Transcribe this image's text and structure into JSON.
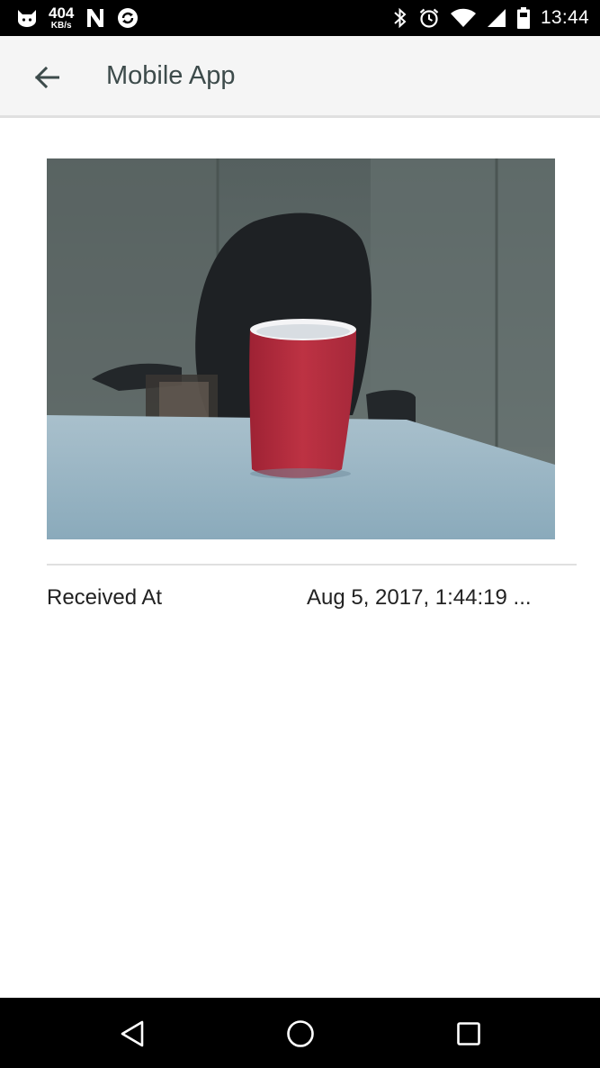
{
  "status_bar": {
    "net_speed_value": "404",
    "net_speed_unit": "KB/s",
    "time": "13:44",
    "left_icons": [
      "cat-icon",
      "network-speed",
      "n-icon",
      "sync-icon"
    ],
    "right_icons": [
      "bluetooth-icon",
      "alarm-icon",
      "wifi-icon",
      "signal-icon",
      "battery-icon"
    ]
  },
  "app_bar": {
    "title": "Mobile App",
    "back_icon": "arrow-left-icon"
  },
  "content": {
    "image": {
      "description_icon": "photo-red-cup-on-desk",
      "colors": {
        "cup": "#b12d3f",
        "desk": "#8fafc0",
        "wall": "#5f6b69",
        "chair": "#1e2124"
      }
    },
    "detail": {
      "label": "Received At",
      "value": "Aug 5, 2017, 1:44:19 ..."
    }
  },
  "nav_bar": {
    "buttons": [
      "back-triangle-icon",
      "home-circle-icon",
      "recents-square-icon"
    ]
  },
  "colors": {
    "status_bar_bg": "#000000",
    "app_bar_bg": "#f5f5f5",
    "title_text": "#3d4b4b",
    "divider": "#e0e0e0"
  }
}
